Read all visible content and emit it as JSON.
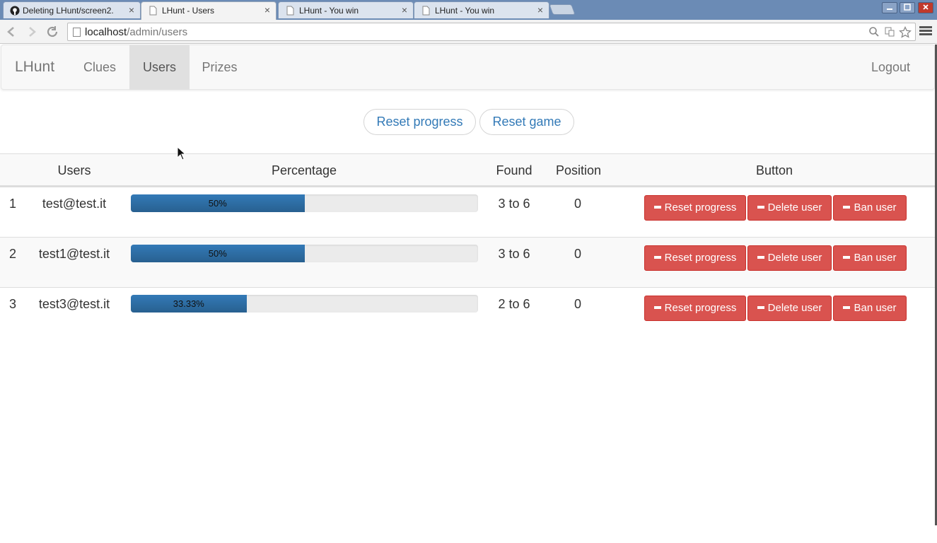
{
  "browser": {
    "tabs": [
      {
        "label": "Deleting LHunt/screen2.",
        "icon": "github-icon"
      },
      {
        "label": "LHunt - Users",
        "icon": "page-icon"
      },
      {
        "label": "LHunt - You win",
        "icon": "page-icon"
      },
      {
        "label": "LHunt - You win",
        "icon": "page-icon"
      }
    ],
    "tab_close": "×",
    "url_host": "localhost",
    "url_path": "/admin/users"
  },
  "navbar": {
    "brand": "LHunt",
    "links": [
      "Clues",
      "Users",
      "Prizes"
    ],
    "active": "Users",
    "logout": "Logout"
  },
  "actions": {
    "reset_progress": "Reset progress",
    "reset_game": "Reset game"
  },
  "table": {
    "headers": [
      "Users",
      "Percentage",
      "Found",
      "Position",
      "Button"
    ],
    "rows": [
      {
        "index": "1",
        "email": "test@test.it",
        "percent_label": "50%",
        "percent": 50,
        "found": "3 to 6",
        "position": "0"
      },
      {
        "index": "2",
        "email": "test1@test.it",
        "percent_label": "50%",
        "percent": 50,
        "found": "3 to 6",
        "position": "0"
      },
      {
        "index": "3",
        "email": "test3@test.it",
        "percent_label": "33.33%",
        "percent": 33.33,
        "found": "2 to 6",
        "position": "0"
      }
    ],
    "row_buttons": {
      "reset": "Reset progress",
      "delete": "Delete user",
      "ban": "Ban user"
    }
  },
  "colors": {
    "primary": "#337ab7",
    "danger": "#d9534f",
    "navbar_bg": "#f8f8f8"
  }
}
